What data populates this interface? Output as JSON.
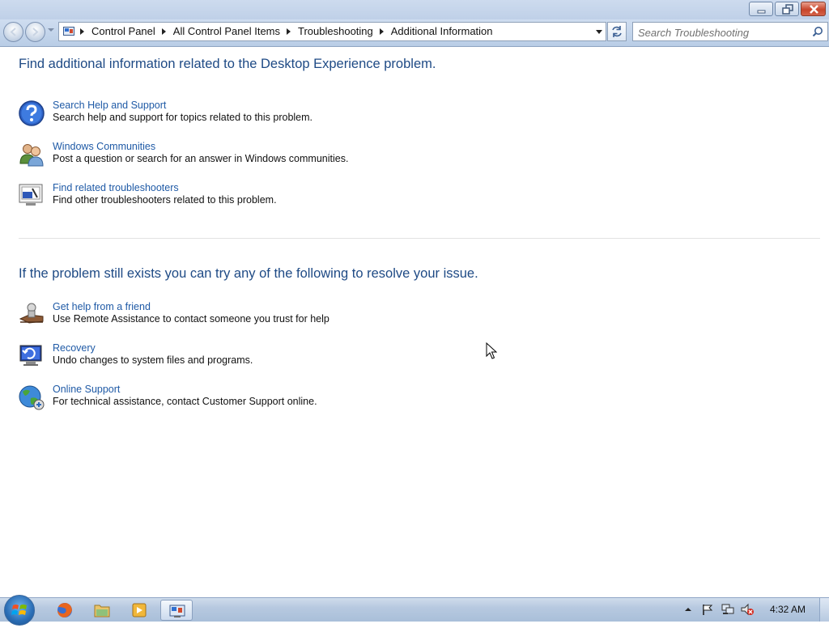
{
  "window": {
    "controls": {
      "minimize": "minimize-icon",
      "maximize": "restore-icon",
      "close": "close-icon"
    }
  },
  "nav": {
    "breadcrumbs": [
      "Control Panel",
      "All Control Panel Items",
      "Troubleshooting",
      "Additional Information"
    ],
    "search_placeholder": "Search Troubleshooting"
  },
  "main": {
    "heading1": "Find additional information related to the Desktop Experience problem.",
    "section1_items": [
      {
        "icon": "help-question-icon",
        "title": "Search Help and Support",
        "desc": "Search help and support for topics related to this problem."
      },
      {
        "icon": "users-community-icon",
        "title": "Windows Communities",
        "desc": "Post a question or search for an answer in Windows communities."
      },
      {
        "icon": "troubleshooter-monitor-icon",
        "title": "Find related troubleshooters",
        "desc": "Find other troubleshooters related to this problem."
      }
    ],
    "heading2": "If the problem still exists you can try any of the following to resolve your issue.",
    "section2_items": [
      {
        "icon": "remote-assistance-icon",
        "title": "Get help from a friend",
        "desc": "Use Remote Assistance to contact someone you trust for help"
      },
      {
        "icon": "recovery-icon",
        "title": "Recovery",
        "desc": "Undo changes to system files and programs."
      },
      {
        "icon": "online-support-globe-icon",
        "title": "Online Support",
        "desc": "For technical assistance, contact Customer Support online."
      }
    ]
  },
  "taskbar": {
    "apps": [
      "start-orb-icon",
      "firefox-icon",
      "file-explorer-icon",
      "media-player-icon",
      "control-panel-icon"
    ],
    "tray_icons": [
      "show-hidden-icons-icon",
      "action-center-flag-icon",
      "network-icon",
      "volume-muted-icon"
    ],
    "clock": "4:32 AM"
  },
  "colors": {
    "heading": "#1e4a85",
    "link": "#1f5aa6",
    "text": "#111111"
  }
}
